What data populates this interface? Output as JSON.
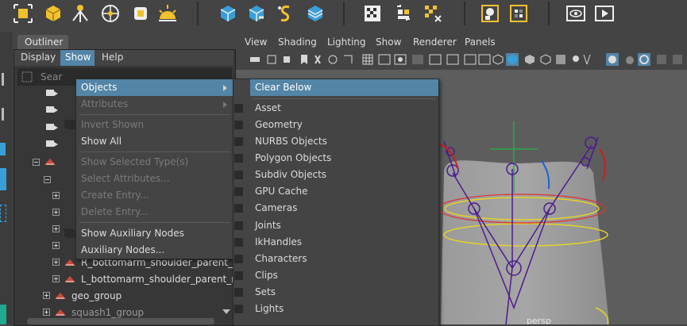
{
  "outliner": {
    "tab_title": "Outliner",
    "menubar": [
      "Display",
      "Show",
      "Help"
    ],
    "search_placeholder": "Sear",
    "tree": [
      {
        "label": "R_bottomarm_shoulder_parent_"
      },
      {
        "label": "L_bottomarm_shoulder_parent_r"
      },
      {
        "label": "geo_group"
      },
      {
        "label": "squash1_group"
      }
    ]
  },
  "viewport": {
    "menubar": [
      "View",
      "Shading",
      "Lighting",
      "Show",
      "Renderer",
      "Panels"
    ],
    "camera_label": "persp"
  },
  "show_menu": {
    "items": [
      {
        "label": "Objects",
        "state": "highlighted",
        "submenu": true
      },
      {
        "label": "Attributes",
        "state": "disabled",
        "submenu": true
      },
      {
        "label": "Invert Shown",
        "state": "disabled",
        "checkbox": true
      },
      {
        "label": "Show All",
        "state": "enabled"
      },
      {
        "label": "Show Selected Type(s)",
        "state": "disabled"
      },
      {
        "label": "Select Attributes...",
        "state": "disabled"
      },
      {
        "label": "Create Entry...",
        "state": "disabled"
      },
      {
        "label": "Delete Entry...",
        "state": "disabled"
      },
      {
        "label": "Show Auxiliary Nodes",
        "state": "enabled",
        "checkbox": true
      },
      {
        "label": "Auxiliary Nodes...",
        "state": "enabled"
      }
    ]
  },
  "objects_submenu": {
    "items": [
      {
        "label": "Clear Below",
        "state": "highlighted"
      },
      {
        "label": "Asset"
      },
      {
        "label": "Geometry"
      },
      {
        "label": "NURBS Objects"
      },
      {
        "label": "Polygon Objects"
      },
      {
        "label": "Subdiv Objects"
      },
      {
        "label": "GPU Cache"
      },
      {
        "label": "Cameras"
      },
      {
        "label": "Joints"
      },
      {
        "label": "IkHandles"
      },
      {
        "label": "Characters"
      },
      {
        "label": "Clips"
      },
      {
        "label": "Sets"
      },
      {
        "label": "Lights"
      }
    ]
  },
  "colors": {
    "highlight": "#5285a6",
    "background": "#444444",
    "disabled_text": "#7a7a7a"
  }
}
